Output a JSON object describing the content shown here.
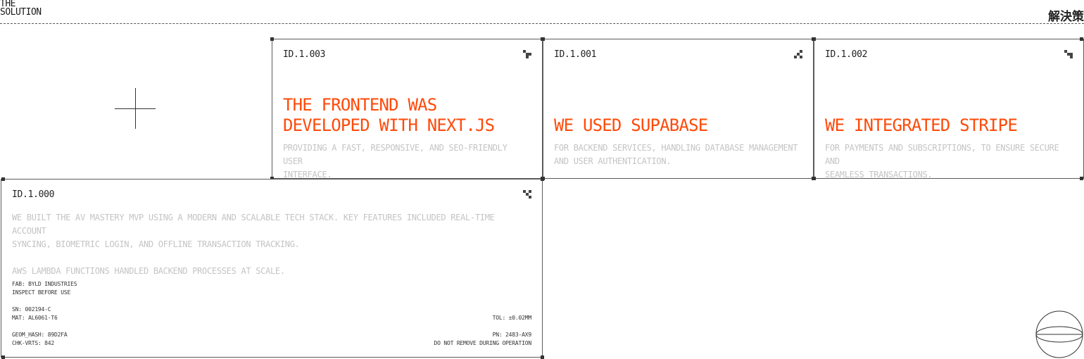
{
  "section": {
    "title_line1": "THE",
    "title_line2": "SOLUTION",
    "title_jp": "解決策"
  },
  "cards": [
    {
      "id": "ID.1.003",
      "headline_line1": "THE FRONTEND WAS",
      "headline_line2": "DEVELOPED WITH NEXT.JS",
      "desc_line1": "PROVIDING A FAST, RESPONSIVE, AND SEO-FRIENDLY USER",
      "desc_line2": "INTERFACE."
    },
    {
      "id": "ID.1.001",
      "headline_line1": "WE USED SUPABASE",
      "desc_line1": "FOR BACKEND SERVICES, HANDLING DATABASE MANAGEMENT",
      "desc_line2": "AND USER AUTHENTICATION."
    },
    {
      "id": "ID.1.002",
      "headline_line1": "WE INTEGRATED STRIPE",
      "desc_line1": "FOR PAYMENTS AND SUBSCRIPTIONS, TO ENSURE SECURE AND",
      "desc_line2": "SEAMLESS TRANSACTIONS."
    }
  ],
  "main_card": {
    "id": "ID.1.000",
    "desc_line1": "WE BUILT THE AV MASTERY MVP USING A MODERN AND SCALABLE TECH STACK. KEY FEATURES INCLUDED REAL-TIME ACCOUNT",
    "desc_line2": "SYNCING, BIOMETRIC LOGIN, AND OFFLINE TRANSACTION TRACKING.",
    "desc_line3": "AWS LAMBDA FUNCTIONS HANDLED BACKEND PROCESSES AT SCALE.",
    "spec": {
      "fab": "FAB: BYLD INDUSTRIES",
      "inspect": "INSPECT BEFORE USE",
      "sn": "SN: 002194-C",
      "mat": "MAT: AL6061-T6",
      "tol": "TOL: ±0.02MM",
      "geom_hash": "GEOM_HASH: 89D2FA",
      "chk_vrts": "CHK-VRTS: 842",
      "pn": "PN: 2483-AX9",
      "warning": "DO NOT REMOVE DURING OPERATION"
    }
  },
  "icons": {
    "card_icon": "pixel-glyph-icon",
    "crosshair": "crosshair-icon",
    "globe": "globe-icon"
  },
  "colors": {
    "accent": "#ff4a0a",
    "muted_text": "#c4c4c4",
    "border": "#5a5a5a"
  }
}
